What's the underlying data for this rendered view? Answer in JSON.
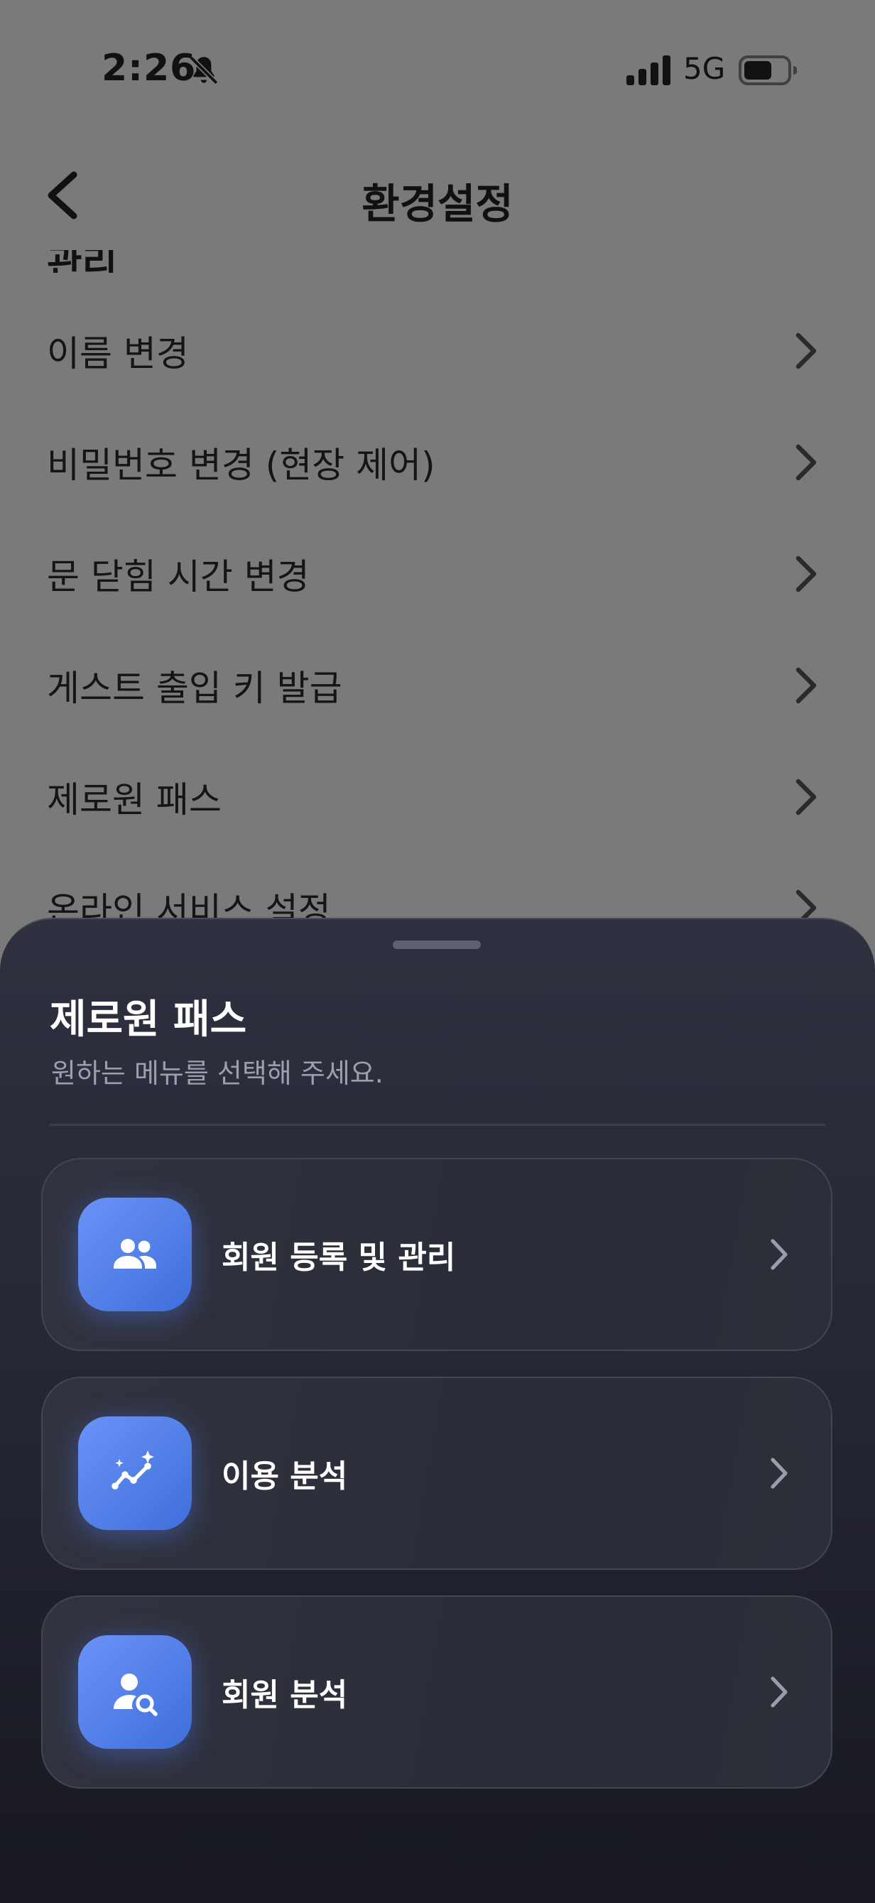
{
  "status_bar": {
    "time": "2:26",
    "network": "5G"
  },
  "header": {
    "title": "환경설정",
    "partial_section": "관리"
  },
  "settings_items": [
    {
      "label": "이름 변경"
    },
    {
      "label": "비밀번호 변경 (현장 제어)"
    },
    {
      "label": "문 닫힘 시간 변경"
    },
    {
      "label": "게스트 출입 키 발급"
    },
    {
      "label": "제로원 패스"
    },
    {
      "label": "온라인 서비스 설정"
    }
  ],
  "sheet": {
    "title": "제로원 패스",
    "subtitle": "원하는 메뉴를 선택해 주세요.",
    "options": [
      {
        "label": "회원 등록 및 관리",
        "icon": "users-icon"
      },
      {
        "label": "이용 분석",
        "icon": "trend-sparkle-icon"
      },
      {
        "label": "회원 분석",
        "icon": "user-search-icon"
      }
    ]
  },
  "colors": {
    "accent": "#4f7ee8",
    "sheet_bg": "#252734",
    "overlay": "#7a7a7a"
  }
}
